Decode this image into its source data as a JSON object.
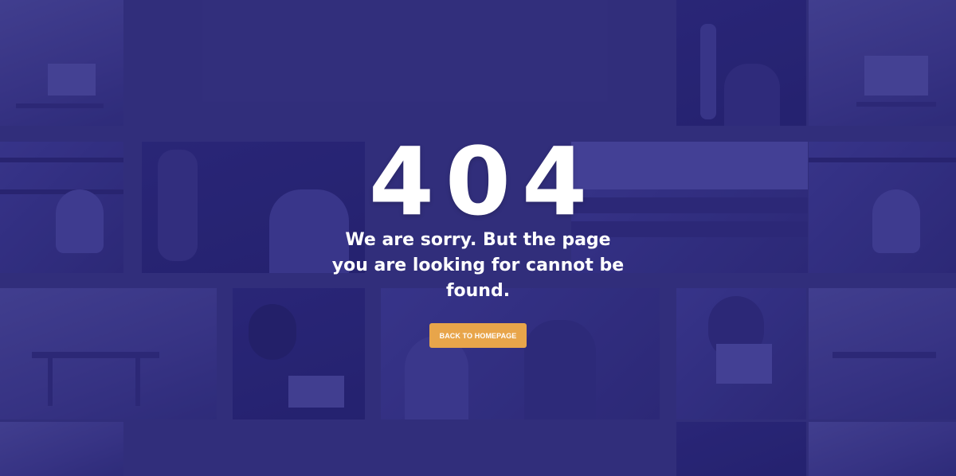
{
  "error": {
    "code": "404",
    "message": "We are sorry. But the page you are looking for cannot be found.",
    "button_label": "BACK TO HOMEPAGE"
  },
  "colors": {
    "background": "#322f7c",
    "button": "#e8a54a",
    "text": "#ffffff"
  }
}
